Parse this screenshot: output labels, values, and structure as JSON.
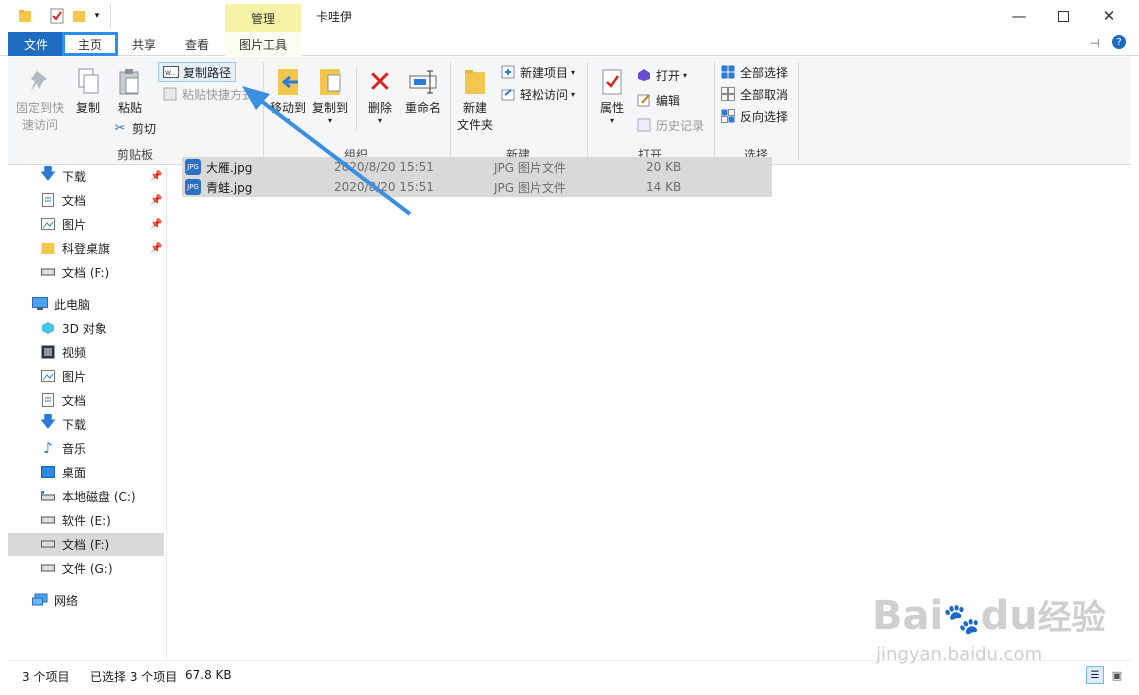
{
  "window": {
    "title": "卡哇伊",
    "context_tab": "管理"
  },
  "tabs": {
    "file": "文件",
    "home": "主页",
    "share": "共享",
    "view": "查看",
    "picture_tools": "图片工具"
  },
  "clipboard": {
    "pin_label_1": "固定到快",
    "pin_label_2": "速访问",
    "copy": "复制",
    "paste": "粘贴",
    "copy_path": "复制路径",
    "paste_shortcut": "粘贴快捷方式",
    "cut": "剪切",
    "group": "剪贴板"
  },
  "organize": {
    "move_to": "移动到",
    "copy_to": "复制到",
    "delete": "删除",
    "rename": "重命名",
    "group": "组织"
  },
  "new": {
    "new_item": "新建项目",
    "easy_access": "轻松访问",
    "new_folder_1": "新建",
    "new_folder_2": "文件夹",
    "group": "新建"
  },
  "open": {
    "properties": "属性",
    "open": "打开",
    "edit": "编辑",
    "history": "历史记录",
    "group": "打开"
  },
  "select": {
    "select_all": "全部选择",
    "select_none": "全部取消",
    "invert": "反向选择",
    "group": "选择"
  },
  "nav": {
    "quick": [
      "下载",
      "文档",
      "图片",
      "科登桌旗",
      "文档 (F:)"
    ],
    "this_pc": "此电脑",
    "pc_items": [
      "3D 对象",
      "视频",
      "图片",
      "文档",
      "下载",
      "音乐",
      "桌面",
      "本地磁盘 (C:)",
      "软件 (E:)",
      "文档 (F:)",
      "文件 (G:)"
    ],
    "network": "网络"
  },
  "files": [
    {
      "name": "大雁.jpg",
      "date": "2020/8/20 15:51",
      "type": "JPG 图片文件",
      "size": "20 KB"
    },
    {
      "name": "青蛙.jpg",
      "date": "2020/8/20 15:51",
      "type": "JPG 图片文件",
      "size": "14 KB"
    }
  ],
  "file_icon_label": "JPG",
  "status": {
    "count": "3 个项目",
    "selected": "已选择 3 个项目",
    "size": "67.8 KB"
  },
  "watermark": {
    "brand": "Bai",
    "brand2": "du",
    "brand_cn": "经验",
    "url": "jingyan.baidu.com"
  },
  "colors": {
    "accent": "#1e6cc2",
    "highlight": "#2c8ff0",
    "arrow": "#3b8fe0",
    "selection": "#d9d9d9"
  }
}
